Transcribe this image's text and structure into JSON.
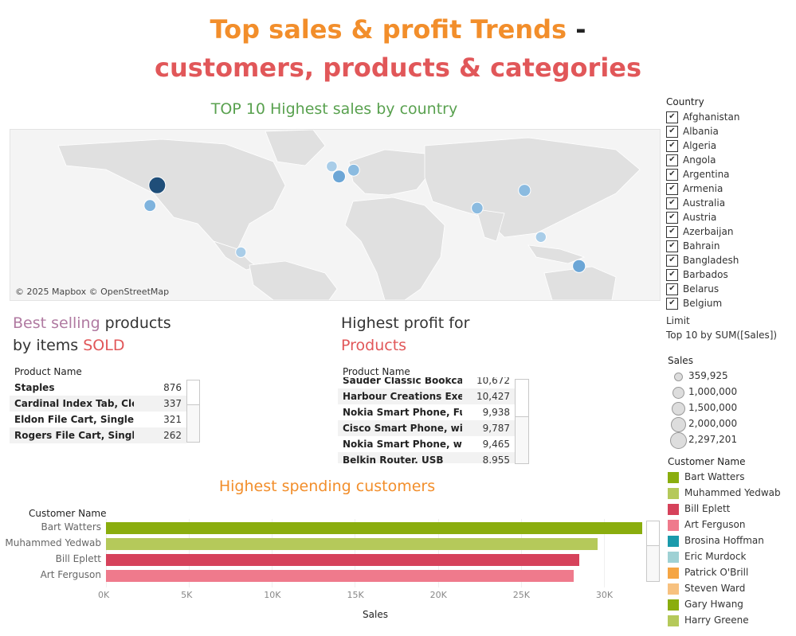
{
  "header": {
    "title_part1": "Top sales & profit Trends",
    "title_dash": " -",
    "title_line2": "customers, products & categories",
    "color_orange": "#f28e2b",
    "color_red": "#e15759",
    "color_dark": "#222222"
  },
  "map": {
    "title": "TOP 10 Highest sales by country",
    "credit": "© 2025 Mapbox © OpenStreetMap",
    "points": [
      {
        "country": "United States",
        "lon": -98,
        "lat": 39,
        "sales": 2297201,
        "color": "#1f4e79"
      },
      {
        "country": "Mexico",
        "lon": -102,
        "lat": 23,
        "sales": 622590,
        "color": "#7fb3dd"
      },
      {
        "country": "Brazil",
        "lon": -52,
        "lat": -14,
        "sales": 359925,
        "color": "#a9cde8"
      },
      {
        "country": "France",
        "lon": 2,
        "lat": 46,
        "sales": 858931,
        "color": "#6ca6d6"
      },
      {
        "country": "United Kingdom",
        "lon": -2,
        "lat": 54,
        "sales": 424215,
        "color": "#a9cde8"
      },
      {
        "country": "Germany",
        "lon": 10,
        "lat": 51,
        "sales": 628840,
        "color": "#8bbbe0"
      },
      {
        "country": "India",
        "lon": 78,
        "lat": 21,
        "sales": 589650,
        "color": "#8bbbe0"
      },
      {
        "country": "China",
        "lon": 104,
        "lat": 35,
        "sales": 700591,
        "color": "#8bbbe0"
      },
      {
        "country": "Indonesia",
        "lon": 113,
        "lat": -2,
        "sales": 404887,
        "color": "#a9cde8"
      },
      {
        "country": "Australia",
        "lon": 134,
        "lat": -25,
        "sales": 925236,
        "color": "#6ca6d6"
      }
    ]
  },
  "best_selling": {
    "title_colored": "Best selling",
    "title_rest": " products",
    "title_line2_plain": "by items ",
    "title_line2_colored": "SOLD",
    "header": "Product Name",
    "rows": [
      {
        "name": "Staples",
        "value": "876"
      },
      {
        "name": "Cardinal Index Tab, Clear",
        "value": "337"
      },
      {
        "name": "Eldon File Cart, Single Wi..",
        "value": "321"
      },
      {
        "name": "Rogers File Cart, Single W..",
        "value": "262"
      }
    ]
  },
  "highest_profit": {
    "title_line1": "Highest profit for",
    "title_line2": "Products",
    "header": "Product Name",
    "rows": [
      {
        "name": "Sauder Classic Bookcase, ..",
        "value": "10,672"
      },
      {
        "name": "Harbour Creations Execut..",
        "value": "10,427"
      },
      {
        "name": "Nokia Smart Phone, Full S..",
        "value": "9,938"
      },
      {
        "name": "Cisco Smart Phone, with C..",
        "value": "9,787"
      },
      {
        "name": "Nokia Smart Phone, with ..",
        "value": "9,465"
      },
      {
        "name": "Belkin Router, USB",
        "value": "8,955"
      }
    ]
  },
  "customers_chart": {
    "title": "Highest spending customers",
    "chart_data": {
      "type": "bar",
      "orientation": "horizontal",
      "title": "Highest spending customers",
      "ylabel": "Customer Name",
      "xlabel": "Sales",
      "xlim": [
        0,
        32500
      ],
      "ticks": [
        "0K",
        "5K",
        "10K",
        "15K",
        "20K",
        "25K",
        "30K"
      ],
      "tick_values": [
        0,
        5000,
        10000,
        15000,
        20000,
        25000,
        30000
      ],
      "categories": [
        "Bart Watters",
        "Muhammed Yedwab",
        "Bill Eplett",
        "Art Ferguson"
      ],
      "values": [
        32300,
        29600,
        28500,
        28200
      ],
      "colors": [
        "#8aad0e",
        "#b5c95a",
        "#d6425b",
        "#ef7a8c"
      ]
    }
  },
  "filter": {
    "title": "Country",
    "items": [
      "Afghanistan",
      "Albania",
      "Algeria",
      "Angola",
      "Argentina",
      "Armenia",
      "Australia",
      "Austria",
      "Azerbaijan",
      "Bahrain",
      "Bangladesh",
      "Barbados",
      "Belarus",
      "Belgium"
    ],
    "check": "✔",
    "limit_label": "Limit",
    "limit_value": "Top 10 by SUM([Sales])"
  },
  "size_legend": {
    "title": "Sales",
    "items": [
      "359,925",
      "1,000,000",
      "1,500,000",
      "2,000,000",
      "2,297,201"
    ]
  },
  "color_legend": {
    "title": "Customer Name",
    "items": [
      {
        "name": "Bart Watters",
        "color": "#8aad0e"
      },
      {
        "name": "Muhammed Yedwab",
        "color": "#b5c95a"
      },
      {
        "name": "Bill Eplett",
        "color": "#d6425b"
      },
      {
        "name": "Art Ferguson",
        "color": "#ef7a8c"
      },
      {
        "name": "Brosina Hoffman",
        "color": "#1a9aab"
      },
      {
        "name": "Eric Murdock",
        "color": "#9fd1d4"
      },
      {
        "name": "Patrick O'Brill",
        "color": "#f5a543"
      },
      {
        "name": "Steven Ward",
        "color": "#f7c17f"
      },
      {
        "name": "Gary Hwang",
        "color": "#8aad0e"
      },
      {
        "name": "Harry Greene",
        "color": "#b5c95a"
      }
    ]
  }
}
